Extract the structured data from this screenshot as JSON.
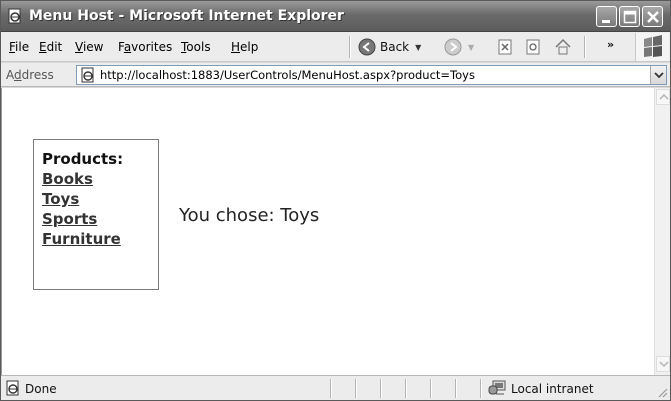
{
  "window": {
    "title": "Menu Host - Microsoft Internet Explorer"
  },
  "menubar": {
    "items": [
      {
        "accel": "F",
        "rest": "ile"
      },
      {
        "accel": "E",
        "rest": "dit"
      },
      {
        "accel": "V",
        "rest": "iew"
      },
      {
        "pre": "F",
        "accel": "a",
        "rest": "vorites"
      },
      {
        "accel": "T",
        "rest": "ools"
      },
      {
        "accel": "H",
        "rest": "elp"
      }
    ],
    "back_label": "Back",
    "overflow_glyph": "»"
  },
  "address": {
    "label_pre": "A",
    "label_accel": "d",
    "label_rest": "dress",
    "url": "http://localhost:1883/UserControls/MenuHost.aspx?product=Toys"
  },
  "page": {
    "menu_title": "Products:",
    "links": [
      "Books",
      "Toys",
      "Sports",
      "Furniture"
    ],
    "chosen_text": "You chose: Toys"
  },
  "status": {
    "text": "Done",
    "zone": "Local intranet"
  },
  "colors": {
    "titlebar": "#6b6b6b",
    "link": "#333333"
  }
}
